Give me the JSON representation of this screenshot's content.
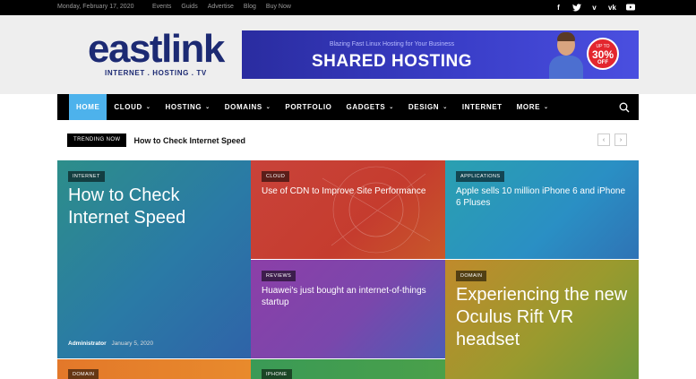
{
  "topbar": {
    "date": "Monday, February 17, 2020",
    "links": [
      "Events",
      "Guids",
      "Advertise",
      "Blog",
      "Buy Now"
    ],
    "socials": [
      {
        "name": "facebook-icon",
        "glyph": "f"
      },
      {
        "name": "twitter-icon",
        "glyph": "t"
      },
      {
        "name": "vimeo-icon",
        "glyph": "v"
      },
      {
        "name": "vk-icon",
        "glyph": "vk"
      },
      {
        "name": "youtube-icon",
        "glyph": "▶"
      }
    ]
  },
  "logo": {
    "wordmark": "eastlink",
    "tagline": "INTERNET . HOSTING . TV"
  },
  "banner": {
    "subtitle": "Blazing Fast Linux Hosting for Your Business",
    "headline": "SHARED HOSTING",
    "badge_top": "UP TO",
    "badge_value": "30%",
    "badge_bottom": "OFF"
  },
  "nav": {
    "items": [
      {
        "label": "HOME",
        "active": true,
        "dropdown": false
      },
      {
        "label": "CLOUD",
        "active": false,
        "dropdown": true
      },
      {
        "label": "HOSTING",
        "active": false,
        "dropdown": true
      },
      {
        "label": "DOMAINS",
        "active": false,
        "dropdown": true
      },
      {
        "label": "PORTFOLIO",
        "active": false,
        "dropdown": false
      },
      {
        "label": "GADGETS",
        "active": false,
        "dropdown": true
      },
      {
        "label": "DESIGN",
        "active": false,
        "dropdown": true
      },
      {
        "label": "INTERNET",
        "active": false,
        "dropdown": false
      },
      {
        "label": "MORE",
        "active": false,
        "dropdown": true
      }
    ],
    "active_color": "#4db2ec"
  },
  "trending": {
    "label": "TRENDING NOW",
    "headline": "How to Check Internet Speed",
    "prev": "‹",
    "next": "›"
  },
  "tiles": {
    "big": {
      "category": "INTERNET",
      "title": "How to Check Internet Speed",
      "author": "Administrator",
      "date": "January 5, 2020"
    },
    "cdn": {
      "category": "CLOUD",
      "title": "Use of CDN to Improve Site Performance"
    },
    "apple": {
      "category": "APPLICATIONS",
      "title": "Apple sells 10 million iPhone 6 and iPhone 6 Pluses"
    },
    "huawei": {
      "category": "REVIEWS",
      "title": "Huawei's just bought an internet-of-things startup"
    },
    "oculus": {
      "category": "DOMAIN",
      "title": "Experiencing the new Oculus Rift VR headset"
    },
    "bottom_left": {
      "category": "DOMAIN"
    },
    "bottom_mid": {
      "category": "IPHONE"
    }
  }
}
